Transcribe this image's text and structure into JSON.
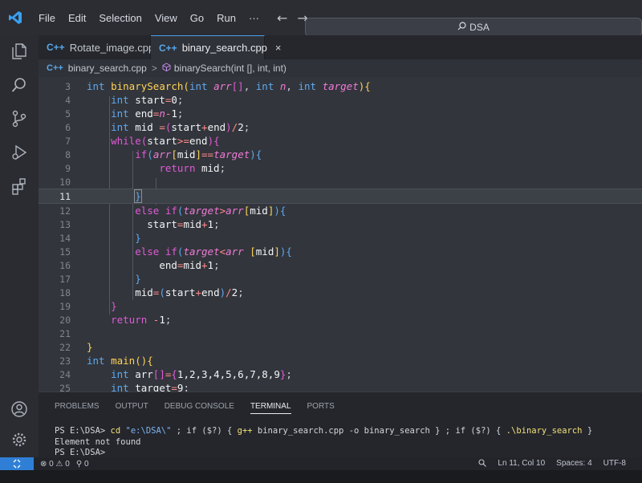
{
  "menu": {
    "items": [
      "File",
      "Edit",
      "Selection",
      "View",
      "Go",
      "Run",
      "···"
    ],
    "back_arrow": "←",
    "forward_arrow": "→"
  },
  "command_center": {
    "text": "DSA",
    "icon": "search-icon"
  },
  "activity_bar": {
    "icons": [
      "explorer-icon",
      "search-icon",
      "source-control-icon",
      "run-debug-icon",
      "extensions-icon",
      "account-icon",
      "settings-gear-icon"
    ]
  },
  "tabs": [
    {
      "label": "Rotate_image.cpp",
      "icon": "C++",
      "active": false
    },
    {
      "label": "binary_search.cpp",
      "icon": "C++",
      "active": true,
      "close": "×"
    }
  ],
  "breadcrumb": {
    "file": "binary_search.cpp",
    "icon": "C++",
    "separator": ">",
    "symbol": "binarySearch(int [], int, int)"
  },
  "editor": {
    "current_line": 11,
    "lines": [
      {
        "n": "3",
        "text": "int binarySearch(int arr[], int n, int target){"
      },
      {
        "n": "4",
        "text": "    int start=0;"
      },
      {
        "n": "5",
        "text": "    int end=n-1;"
      },
      {
        "n": "6",
        "text": "    int mid =(start+end)/2;"
      },
      {
        "n": "7",
        "text": "    while(start>=end){"
      },
      {
        "n": "8",
        "text": "        if(arr[mid]==target){"
      },
      {
        "n": "9",
        "text": "            return mid;"
      },
      {
        "n": "10",
        "text": ""
      },
      {
        "n": "11",
        "text": "        }"
      },
      {
        "n": "12",
        "text": "        else if(target>arr[mid]){"
      },
      {
        "n": "13",
        "text": "          start=mid+1;"
      },
      {
        "n": "14",
        "text": "        }"
      },
      {
        "n": "15",
        "text": "        else if(target<arr [mid]){"
      },
      {
        "n": "16",
        "text": "            end=mid+1;"
      },
      {
        "n": "17",
        "text": "        }"
      },
      {
        "n": "18",
        "text": "        mid=(start+end)/2;"
      },
      {
        "n": "19",
        "text": "    }"
      },
      {
        "n": "20",
        "text": "    return -1;"
      },
      {
        "n": "21",
        "text": ""
      },
      {
        "n": "22",
        "text": "}"
      },
      {
        "n": "23",
        "text": "int main(){"
      },
      {
        "n": "24",
        "text": "    int arr[]={1,2,3,4,5,6,7,8,9};"
      },
      {
        "n": "25",
        "text": "    int target=9;"
      }
    ]
  },
  "panel": {
    "tabs": [
      "PROBLEMS",
      "OUTPUT",
      "DEBUG CONSOLE",
      "TERMINAL",
      "PORTS"
    ],
    "active_tab": "TERMINAL",
    "terminal": {
      "prompt1": "PS E:\\DSA>",
      "cmd_cd": "cd",
      "cmd_path": "\"e:\\DSA\\\"",
      "cmd_rest1": " ; if ($?) { ",
      "cmd_gpp": "g++",
      "cmd_rest2": " binary_search.cpp -o binary_search } ; if ($?) { ",
      "cmd_run": ".\\binary_search",
      "cmd_rest3": " }",
      "output": "Element not found",
      "prompt2": "PS E:\\DSA>"
    }
  },
  "statusbar": {
    "remote_icon": "remote-icon",
    "errors": "0",
    "warnings": "0",
    "ports": "0",
    "zoom_icon": "zoom-icon",
    "position": "Ln 11, Col 10",
    "spaces": "Spaces: 4",
    "encoding": "UTF-8"
  },
  "colors": {
    "keyword": "#5ea9f0",
    "control": "#e05ad8",
    "function": "#ffd35a",
    "parameter": "#f07ad8",
    "accent": "#2f7fd6"
  }
}
